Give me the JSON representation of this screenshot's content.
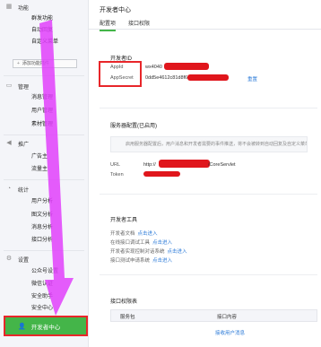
{
  "page_title": "开发者中心",
  "tabs": [
    "配置项",
    "接口权限"
  ],
  "sidebar": {
    "groups": [
      {
        "name": "function",
        "label": "功能",
        "icon": "grid-icon"
      },
      {
        "name": "manage",
        "label": "管理",
        "icon": "monitor-icon"
      },
      {
        "name": "promo",
        "label": "推广",
        "icon": "megaphone-icon"
      },
      {
        "name": "stats",
        "label": "统计",
        "icon": "chart-icon"
      },
      {
        "name": "settings",
        "label": "设置",
        "icon": "gear-icon"
      }
    ],
    "function_items": [
      "群发功能",
      "自动回复",
      "自定义菜单"
    ],
    "add_plugin": "添加功能插件",
    "manage_items": [
      "消息管理",
      "用户管理",
      "素材管理"
    ],
    "promo_items": [
      "广告主",
      "流量主"
    ],
    "stats_items": [
      "用户分析",
      "图文分析",
      "消息分析",
      "接口分析"
    ],
    "settings_items": [
      "公众号设置",
      "微信认证",
      "安全助手",
      "安全中心"
    ],
    "developer_center": "开发者中心"
  },
  "developer_id": {
    "section": "开发者ID",
    "appid_label": "AppId",
    "appid_value": "wx4040",
    "appsecret_label": "AppSecret",
    "appsecret_value": "0dd5e4612c81d8f668",
    "reset": "重置"
  },
  "server_config": {
    "section": "服务器配置(已启用)",
    "notice": "启用服务器配置后，用户消息和开发者需要的事件推送，将不会被转到自动回复及自定义菜单中",
    "url_label": "URL",
    "url_value": "http://",
    "url_suffix": "/CoreServlet",
    "token_label": "Token"
  },
  "dev_tools": {
    "section": "开发者工具",
    "items": [
      {
        "label": "开发者文档",
        "link": "点击进入"
      },
      {
        "label": "在线接口调试工具",
        "link": "点击进入"
      },
      {
        "label": "开发者实现控制对话系统",
        "link": "点击进入"
      },
      {
        "label": "接口测试申请系统",
        "link": "点击进入"
      }
    ]
  },
  "api_permissions": {
    "section": "接口权限表",
    "col1": "服务包",
    "col2": "接口内容",
    "row1_link": "接收用户消息"
  },
  "colors": {
    "accent_green": "#44b549",
    "highlight_red": "#e8262a",
    "arrow_magenta": "#e040fb",
    "link_blue": "#2c7bd8"
  }
}
